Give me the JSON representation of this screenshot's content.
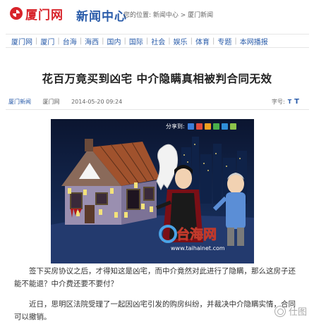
{
  "header": {
    "logo_text": "厦门网",
    "section_title": "新闻中心",
    "location": "您的位置: 新闻中心 > 厦门新闻"
  },
  "nav": {
    "items": [
      "厦门网",
      "厦门",
      "台海",
      "海西",
      "国内",
      "国际",
      "社会",
      "娱乐",
      "体育",
      "专题",
      "本网播报"
    ]
  },
  "article": {
    "headline": "花百万竟买到凶宅 中介隐瞒真相被判合同无效",
    "source": "厦门新闻",
    "site": "厦门网",
    "datetime": "2014-05-20 09:24",
    "fontsize_label": "字号:",
    "fontsize_small": "T",
    "fontsize_large": "T",
    "paragraph1": "签下买房协议之后，才得知这是凶宅，而中介竟然对此进行了隐瞒，那么这房子还能不能退？中介费还要不要付？",
    "paragraph2": "近日，思明区法院受理了一起因凶宅引发的购房纠纷，并裁决中介隐瞒实情，合同可以撤销。"
  },
  "illustration": {
    "share_label": "分享到:",
    "brand": "台海网",
    "url": "www.taihainet.com"
  },
  "watermark": {
    "text": "仕图"
  },
  "colors": {
    "brand_red": "#d8232a",
    "link_blue": "#2a5caa",
    "night_sky": "#0d1b3a"
  }
}
